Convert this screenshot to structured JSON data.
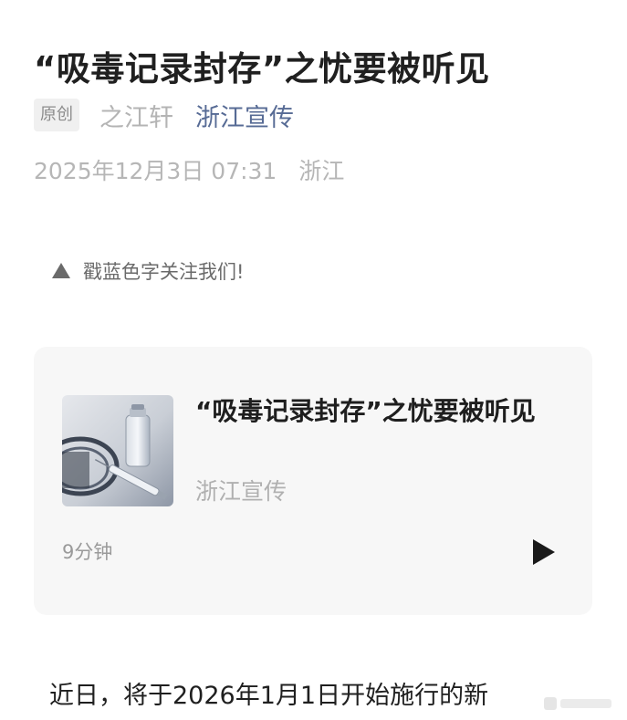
{
  "article": {
    "title": "“吸毒记录封存”之忧要被听见",
    "original_badge": "原创",
    "author": "之江轩",
    "account": "浙江宣传",
    "date": "2025年12月3日 07:31",
    "location": "浙江",
    "follow_hint": "戳蓝色字关注我们!"
  },
  "audio_card": {
    "title": "“吸毒记录封存”之忧要被听见",
    "source": "浙江宣传",
    "duration": "9分钟",
    "cover_icon": "syringe-vial-image",
    "play_icon": "play-icon"
  },
  "body": {
    "first_line": "近日，将于2026年1月1日开始施行的新"
  },
  "colors": {
    "link": "#576b95",
    "muted": "#b4b4b4",
    "card_bg": "#f7f7f7",
    "title": "#202020"
  }
}
